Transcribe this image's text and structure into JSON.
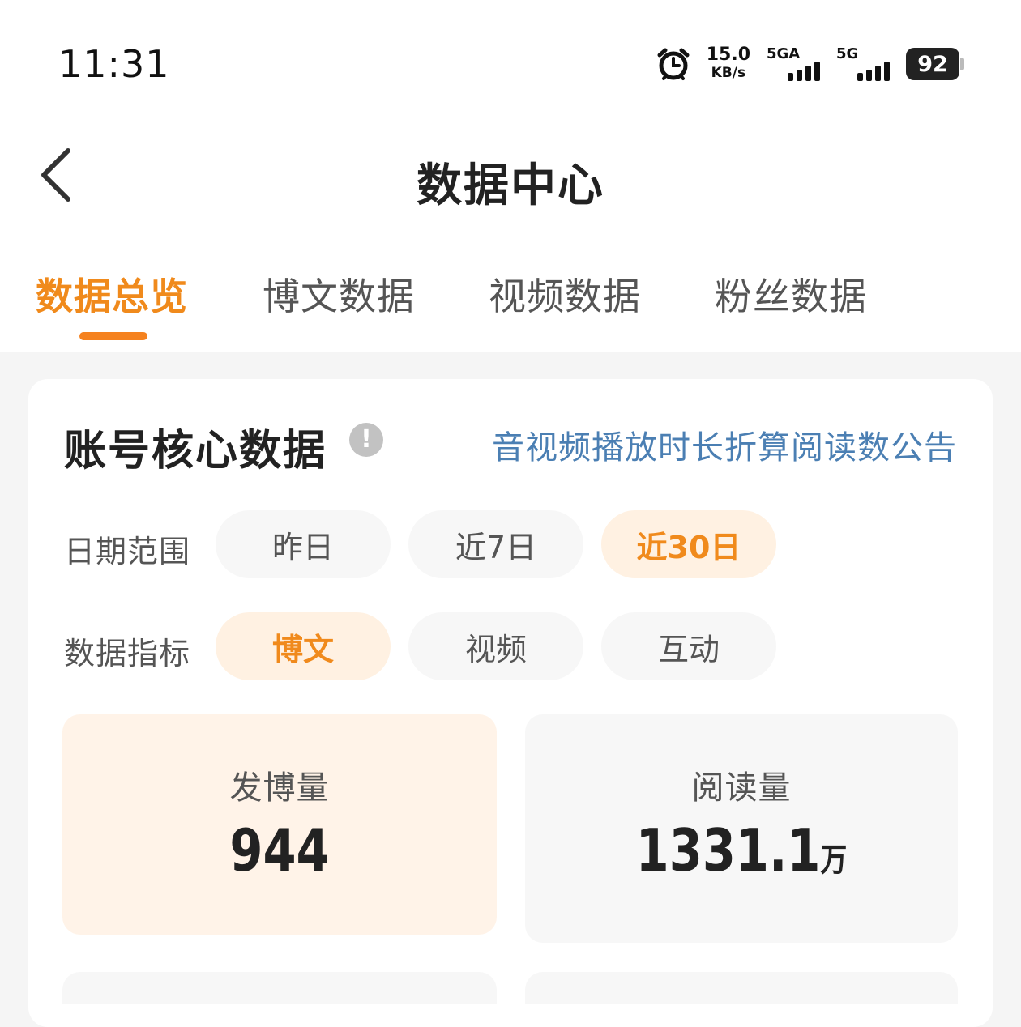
{
  "status_bar": {
    "time": "11:31",
    "speed_value": "15.0",
    "speed_unit": "KB/s",
    "sim1_label": "5GA",
    "sim2_label": "5G",
    "battery": "92"
  },
  "header": {
    "title": "数据中心"
  },
  "tabs": [
    {
      "label": "数据总览",
      "active": true
    },
    {
      "label": "博文数据",
      "active": false
    },
    {
      "label": "视频数据",
      "active": false
    },
    {
      "label": "粉丝数据",
      "active": false
    }
  ],
  "card": {
    "title": "账号核心数据",
    "notice_link": "音视频播放时长折算阅读数公告",
    "date_range": {
      "label": "日期范围",
      "options": [
        "昨日",
        "近7日",
        "近30日"
      ],
      "selected": "近30日"
    },
    "metric": {
      "label": "数据指标",
      "options": [
        "博文",
        "视频",
        "互动"
      ],
      "selected": "博文"
    },
    "stats": [
      {
        "label": "发博量",
        "value": "944",
        "unit": ""
      },
      {
        "label": "阅读量",
        "value": "1331.1",
        "unit": "万"
      }
    ]
  },
  "colors": {
    "accent": "#f08a1c",
    "link": "#4b7fb3",
    "active_bg": "#fff1e2"
  }
}
